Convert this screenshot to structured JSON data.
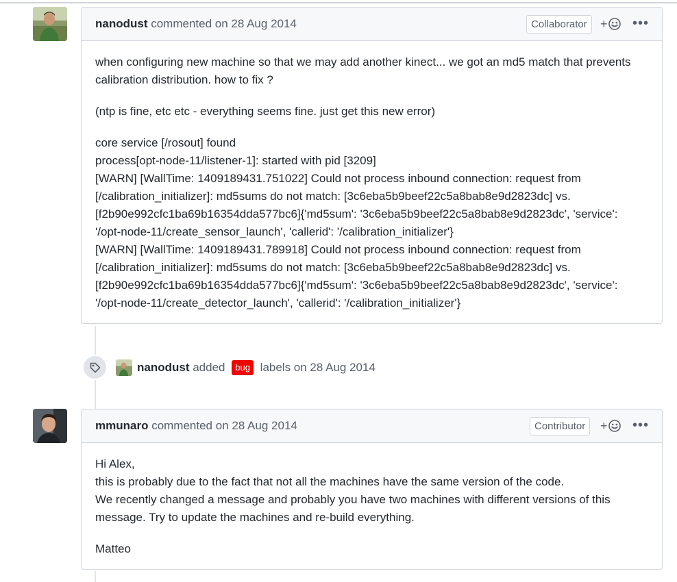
{
  "comments": [
    {
      "author": "nanodust",
      "action": " commented on 28 Aug 2014",
      "role": "Collaborator",
      "reaction_plus": "+",
      "more": "•••",
      "paragraphs": [
        [
          "when configuring new machine so that we may add another kinect... we got an md5 match that prevents",
          "calibration distribution. how to fix ?"
        ],
        [
          "(ntp is fine, etc etc - everything seems fine. just get this new error)"
        ],
        [
          "core service [/rosout] found",
          "process[opt-node-11/listener-1]: started with pid [3209]",
          "[WARN] [WallTime: 1409189431.751022] Could not process inbound connection: request from",
          "[/calibration_initializer]: md5sums do not match: [3c6eba5b9beef22c5a8bab8e9d2823dc] vs.",
          "[f2b90e992cfc1ba69b16354dda577bc6]{'md5sum': '3c6eba5b9beef22c5a8bab8e9d2823dc', 'service':",
          "'/opt-node-11/create_sensor_launch', 'callerid': '/calibration_initializer'}",
          "[WARN] [WallTime: 1409189431.789918] Could not process inbound connection: request from",
          "[/calibration_initializer]: md5sums do not match: [3c6eba5b9beef22c5a8bab8e9d2823dc] vs.",
          "[f2b90e992cfc1ba69b16354dda577bc6]{'md5sum': '3c6eba5b9beef22c5a8bab8e9d2823dc', 'service':",
          "'/opt-node-11/create_detector_launch', 'callerid': '/calibration_initializer'}"
        ]
      ]
    },
    {
      "author": "mmunaro",
      "action": " commented on 28 Aug 2014",
      "role": "Contributor",
      "reaction_plus": "+",
      "more": "•••",
      "paragraphs": [
        [
          "Hi Alex,",
          "this is probably due to the fact that not all the machines have the same version of the code.",
          "We recently changed a message and probably you have two machines with different versions of this",
          "message. Try to update the machines and re-build everything."
        ],
        [
          "Matteo"
        ]
      ]
    }
  ],
  "event": {
    "author": "nanodust",
    "action_before": " added ",
    "label": "bug",
    "action_after": " labels on 28 Aug 2014",
    "icon": "tag-icon"
  },
  "colors": {
    "bug_label": "#ee0701",
    "border": "#d1d5da",
    "header_bg": "#f6f8fa"
  }
}
